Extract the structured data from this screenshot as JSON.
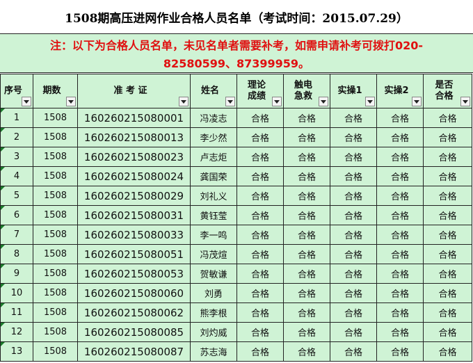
{
  "title": "1508期高压进网作业合格人员名单（考试时间：2015.07.29）",
  "notice_line1": "注：以下为合格人员名单，未见名单者需要补考，如需申请补考可拨打020-",
  "notice_line2": "82580599、87399959。",
  "headers": [
    "序号",
    "期数",
    "准 考 证",
    "姓名",
    "理论\n成绩",
    "触电\n急救",
    "实操1",
    "实操2",
    "是否\n合格"
  ],
  "rows": [
    {
      "no": "1",
      "period": "1508",
      "exam_id": "160260215080001",
      "name": "冯凌志",
      "theory": "合格",
      "first_aid": "合格",
      "practice1": "合格",
      "practice2": "合格",
      "passed": "合格"
    },
    {
      "no": "2",
      "period": "1508",
      "exam_id": "160260215080013",
      "name": "李少然",
      "theory": "合格",
      "first_aid": "合格",
      "practice1": "合格",
      "practice2": "合格",
      "passed": "合格"
    },
    {
      "no": "3",
      "period": "1508",
      "exam_id": "160260215080023",
      "name": "卢志炬",
      "theory": "合格",
      "first_aid": "合格",
      "practice1": "合格",
      "practice2": "合格",
      "passed": "合格"
    },
    {
      "no": "4",
      "period": "1508",
      "exam_id": "160260215080024",
      "name": "龚国荣",
      "theory": "合格",
      "first_aid": "合格",
      "practice1": "合格",
      "practice2": "合格",
      "passed": "合格"
    },
    {
      "no": "5",
      "period": "1508",
      "exam_id": "160260215080029",
      "name": "刘礼义",
      "theory": "合格",
      "first_aid": "合格",
      "practice1": "合格",
      "practice2": "合格",
      "passed": "合格"
    },
    {
      "no": "6",
      "period": "1508",
      "exam_id": "160260215080031",
      "name": "黄钰莹",
      "theory": "合格",
      "first_aid": "合格",
      "practice1": "合格",
      "practice2": "合格",
      "passed": "合格"
    },
    {
      "no": "7",
      "period": "1508",
      "exam_id": "160260215080033",
      "name": "李一鸣",
      "theory": "合格",
      "first_aid": "合格",
      "practice1": "合格",
      "practice2": "合格",
      "passed": "合格"
    },
    {
      "no": "8",
      "period": "1508",
      "exam_id": "160260215080051",
      "name": "冯茂煊",
      "theory": "合格",
      "first_aid": "合格",
      "practice1": "合格",
      "practice2": "合格",
      "passed": "合格"
    },
    {
      "no": "9",
      "period": "1508",
      "exam_id": "160260215080053",
      "name": "贺敏谦",
      "theory": "合格",
      "first_aid": "合格",
      "practice1": "合格",
      "practice2": "合格",
      "passed": "合格"
    },
    {
      "no": "10",
      "period": "1508",
      "exam_id": "160260215080060",
      "name": "刘勇",
      "theory": "合格",
      "first_aid": "合格",
      "practice1": "合格",
      "practice2": "合格",
      "passed": "合格"
    },
    {
      "no": "11",
      "period": "1508",
      "exam_id": "160260215080062",
      "name": "熊李根",
      "theory": "合格",
      "first_aid": "合格",
      "practice1": "合格",
      "practice2": "合格",
      "passed": "合格"
    },
    {
      "no": "12",
      "period": "1508",
      "exam_id": "160260215080085",
      "name": "刘灼威",
      "theory": "合格",
      "first_aid": "合格",
      "practice1": "合格",
      "practice2": "合格",
      "passed": "合格"
    },
    {
      "no": "13",
      "period": "1508",
      "exam_id": "160260215080087",
      "name": "苏志海",
      "theory": "合格",
      "first_aid": "合格",
      "practice1": "合格",
      "practice2": "合格",
      "passed": "合格"
    }
  ],
  "colors": {
    "background": "#cff3d5",
    "notice_text": "#e01010",
    "cell_marker": "#1a7a2a"
  },
  "icons": {
    "filter_button": "dropdown-arrow-icon",
    "cell_marker": "green-triangle-icon"
  }
}
